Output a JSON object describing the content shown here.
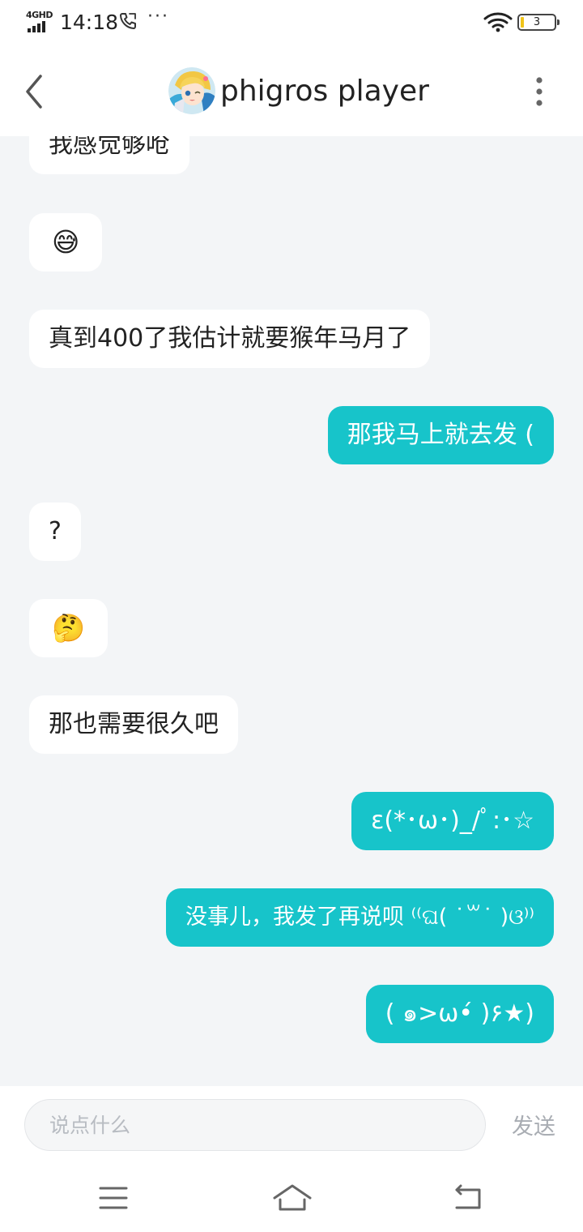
{
  "status_bar": {
    "network": "4GHD",
    "time": "14:18",
    "battery": "3",
    "battery_color": "#f0c419"
  },
  "header": {
    "title": "phigros player",
    "back_icon": "chevron-left-icon",
    "more_icon": "vertical-dots-icon"
  },
  "messages": [
    {
      "side": "in",
      "text": "我感觉够呛"
    },
    {
      "side": "in",
      "text": "😅",
      "emoji": "sweat-smile-emoji"
    },
    {
      "side": "in",
      "text": "真到400了我估计就要猴年马月了"
    },
    {
      "side": "out",
      "text": "那我马上就去发 ("
    },
    {
      "side": "in",
      "text": "?"
    },
    {
      "side": "in",
      "text": "🤔",
      "emoji": "thinking-face-emoji"
    },
    {
      "side": "in",
      "text": "那也需要很久吧"
    },
    {
      "side": "out",
      "text": "ε(*･ω･)_/ﾟ:･☆"
    },
    {
      "side": "out",
      "text": "没事儿，我发了再说呗 ⁽⁽ଘ( ˙꒳˙ )ଓ⁾⁾"
    },
    {
      "side": "out",
      "text": "( ๑>ω•́ )۶★)"
    }
  ],
  "input": {
    "placeholder": "说点什么",
    "value": "",
    "send_label": "发送"
  },
  "nav": {
    "menu_icon": "menu-icon",
    "home_icon": "home-icon",
    "back_icon": "back-arrow-icon"
  },
  "colors": {
    "outgoing_bubble": "#17c4ca",
    "incoming_bubble": "#ffffff",
    "chat_background": "#f3f5f7"
  }
}
